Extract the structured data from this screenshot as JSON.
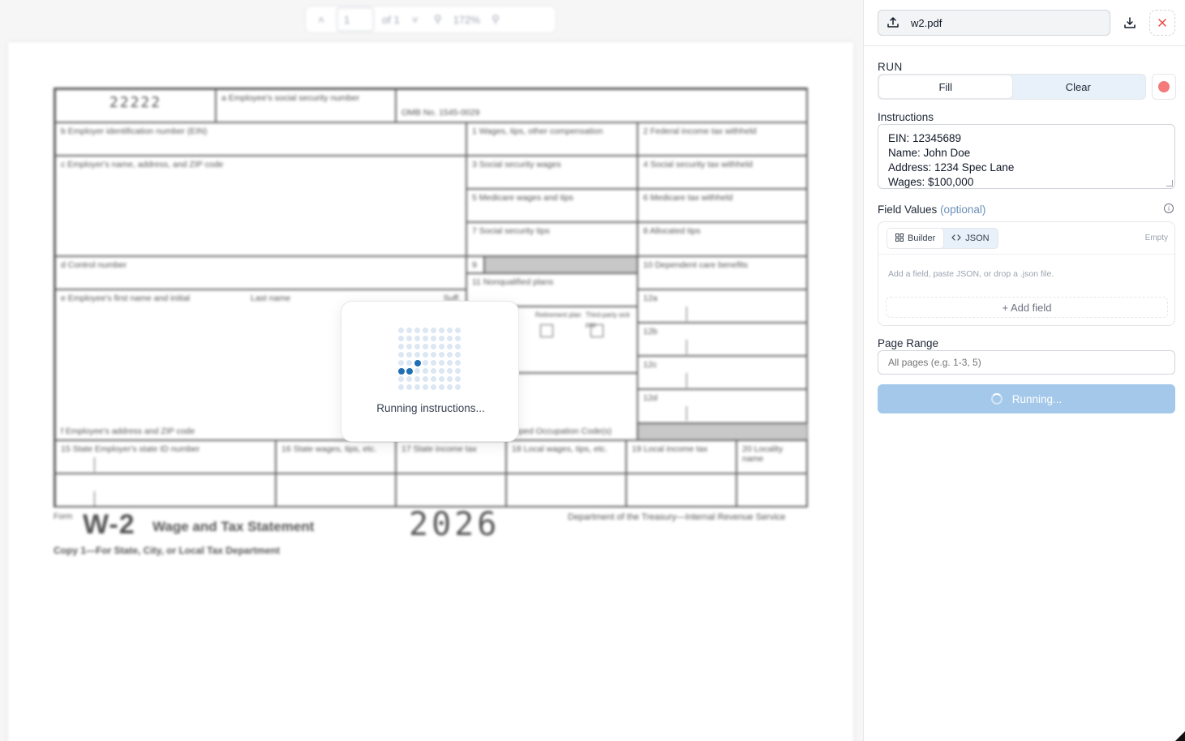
{
  "viewer": {
    "page_input": "1",
    "page_of": "of 1",
    "zoom": "172%",
    "loading_text": "Running instructions..."
  },
  "form": {
    "code": "22222",
    "ssn_label": "a  Employee's social security number",
    "omb": "OMB No. 1545-0029",
    "ein_label": "b  Employer identification number (EIN)",
    "box1": "1   Wages, tips, other compensation",
    "box2": "2   Federal income tax withheld",
    "employer_label": "c  Employer's name, address, and ZIP code",
    "box3": "3   Social security wages",
    "box4": "4   Social security tax withheld",
    "box5": "5   Medicare wages and tips",
    "box6": "6   Medicare tax withheld",
    "box7": "7   Social security tips",
    "box8": "8   Allocated tips",
    "control_label": "d  Control number",
    "box9": "9",
    "box10": "10   Dependent care benefits",
    "employee_label": "e  Employee's first name and initial",
    "last_name": "Last name",
    "suff": "Suff.",
    "box11": "11   Nonqualified plans",
    "box12a": "12a",
    "box12b": "12b",
    "box12c": "12c",
    "box12d": "12d",
    "retirement": "Retirement plan",
    "thirdparty": "Third-party sick pay",
    "tipped": "Tipped Occupation Code(s)",
    "address_label": "f  Employee's address and ZIP code",
    "box15": "15  State    Employer's state ID number",
    "box16": "16  State wages, tips, etc.",
    "box17": "17  State income tax",
    "box18": "18  Local wages, tips, etc.",
    "box19": "19  Local income tax",
    "box20": "20  Locality name",
    "footer_form": "Form",
    "footer_w2": "W-2",
    "footer_title": "Wage and Tax Statement",
    "footer_year": "2026",
    "footer_dept": "Department of the Treasury—Internal Revenue Service",
    "footer_copy": "Copy 1—For State, City, or Local Tax Department"
  },
  "panel": {
    "file_name": "w2.pdf",
    "run_label": "RUN",
    "fill_label": "Fill",
    "clear_label": "Clear",
    "instructions_label": "Instructions",
    "instructions_lines": [
      "EIN: 12345689",
      "Name: John Doe",
      "Address: 1234 Spec Lane",
      "Wages: $100,000"
    ],
    "field_values_label": "Field Values",
    "field_values_optional": "(optional)",
    "builder_tab": "Builder",
    "json_tab": "JSON",
    "empty_label": "Empty",
    "hint": "Add a field, paste JSON, or drop a .json file.",
    "add_field": "+ Add field",
    "page_range_label": "Page Range",
    "page_range_placeholder": "All pages (e.g. 1-3, 5)",
    "running_label": "Running..."
  },
  "colors": {
    "accent_light": "#a4c8ea",
    "record": "#f47b7b",
    "close": "#ef4444",
    "loader_dot": "#1f6fb5"
  }
}
